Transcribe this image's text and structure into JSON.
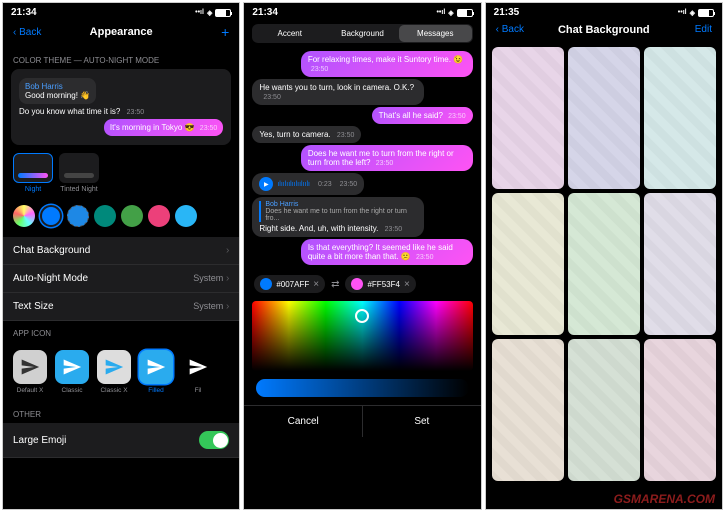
{
  "status": {
    "time1": "21:34",
    "time2": "21:34",
    "time3": "21:35"
  },
  "s1": {
    "back": "Back",
    "title": "Appearance",
    "sect1": "COLOR THEME — AUTO-NIGHT MODE",
    "preview": {
      "sender": "Bob Harris",
      "m1": "Good morning! 👋",
      "m2": "Do you know what time it is?",
      "t1": "23:50",
      "m3": "It's morning in Tokyo 😎",
      "t2": "23:50"
    },
    "themes": [
      {
        "name": "Night"
      },
      {
        "name": "Tinted Night"
      }
    ],
    "colors": [
      "multi",
      "#007aff",
      "#1e88e5",
      "#00897b",
      "#43a047",
      "#ec407a",
      "#29b6f6"
    ],
    "rows": [
      {
        "k": "Chat Background",
        "v": ""
      },
      {
        "k": "Auto-Night Mode",
        "v": "System"
      },
      {
        "k": "Text Size",
        "v": "System"
      }
    ],
    "sect2": "APP ICON",
    "icons": [
      {
        "n": "Default X",
        "bg": "#d0d0d0",
        "fg": "#333"
      },
      {
        "n": "Classic",
        "bg": "#2aabee",
        "fg": "#fff"
      },
      {
        "n": "Classic X",
        "bg": "#ddd",
        "fg": "#2aabee"
      },
      {
        "n": "Filled",
        "bg": "#2aabee",
        "fg": "#fff",
        "sel": true
      },
      {
        "n": "Fil",
        "bg": "#000",
        "fg": "#fff"
      }
    ],
    "sect3": "OTHER",
    "toggle": "Large Emoji"
  },
  "s2": {
    "tabs": [
      "Accent",
      "Background",
      "Messages"
    ],
    "msgs": [
      {
        "t": "out",
        "txt": "For relaxing times, make it Suntory time. 😉",
        "ts": "23:50"
      },
      {
        "t": "in",
        "txt": "He wants you to turn, look in camera. O.K.?",
        "ts": "23:50"
      },
      {
        "t": "out",
        "txt": "That's all he said?",
        "ts": "23:50"
      },
      {
        "t": "in",
        "txt": "Yes, turn to camera.",
        "ts": "23:50"
      },
      {
        "t": "out",
        "txt": "Does he want me to turn from the right or turn from the left?",
        "ts": "23:50"
      },
      {
        "t": "voice",
        "dur": "0:23",
        "ts": "23:50"
      },
      {
        "t": "reply",
        "sender": "Bob Harris",
        "quote": "Does he want me to turn from the right or turn fro...",
        "txt": "Right side. And, uh, with intensity.",
        "ts": "23:50"
      },
      {
        "t": "out",
        "txt": "Is that everything? It seemed like he said quite a bit more than that. 😕",
        "ts": "23:50"
      }
    ],
    "hex1": "#007AFF",
    "hex2": "#FF53F4",
    "cancel": "Cancel",
    "set": "Set"
  },
  "s3": {
    "back": "Back",
    "title": "Chat Background",
    "edit": "Edit",
    "tiles": [
      "#e8d5e8",
      "#d5d5e8",
      "#d5e8e8",
      "#e8e8d5",
      "#d5e8d5",
      "#e0dde8",
      "#e8e0d5",
      "#d5e0d5",
      "#e8d5dd"
    ]
  },
  "watermark": "GSMARENA.COM"
}
